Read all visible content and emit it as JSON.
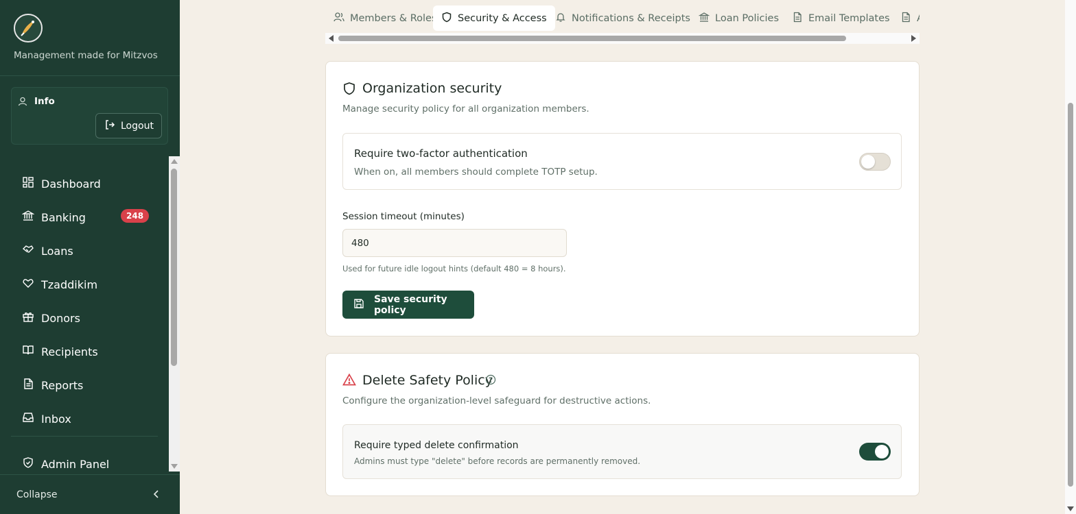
{
  "sidebar": {
    "tagline": "Management made for Mitzvos",
    "user_label": "Info",
    "logout_label": "Logout",
    "nav": [
      {
        "label": "Dashboard",
        "icon": "dashboard-icon"
      },
      {
        "label": "Banking",
        "icon": "bank-icon",
        "badge": "248"
      },
      {
        "label": "Loans",
        "icon": "handshake-icon"
      },
      {
        "label": "Tzaddikim",
        "icon": "heart-hand-icon"
      },
      {
        "label": "Donors",
        "icon": "gift-icon"
      },
      {
        "label": "Recipients",
        "icon": "book-icon"
      },
      {
        "label": "Reports",
        "icon": "document-icon"
      },
      {
        "label": "Inbox",
        "icon": "inbox-icon"
      },
      {
        "label": "Admin Panel",
        "icon": "shield-icon"
      }
    ],
    "collapse_label": "Collapse"
  },
  "tabs": [
    {
      "label": "Members & Roles",
      "icon": "users-icon",
      "active": false
    },
    {
      "label": "Security & Access",
      "icon": "shield-icon",
      "active": true
    },
    {
      "label": "Notifications & Receipts",
      "icon": "bell-icon",
      "active": false
    },
    {
      "label": "Loan Policies",
      "icon": "bank-icon",
      "active": false
    },
    {
      "label": "Email Templates",
      "icon": "document-icon",
      "active": false
    },
    {
      "label": "A",
      "icon": "document-icon",
      "active": false
    }
  ],
  "security": {
    "title": "Organization security",
    "description": "Manage security policy for all organization members.",
    "two_factor_title": "Require two-factor authentication",
    "two_factor_desc": "When on, all members should complete TOTP setup.",
    "two_factor_enabled": false,
    "timeout_label": "Session timeout (minutes)",
    "timeout_value": "480",
    "timeout_hint": "Used for future idle logout hints (default 480 = 8 hours).",
    "save_label": "Save security policy"
  },
  "delete_policy": {
    "title": "Delete Safety Policy",
    "description": "Configure the organization-level safeguard for destructive actions.",
    "confirm_title": "Require typed delete confirmation",
    "confirm_desc": "Admins must type \"delete\" before records are permanently removed.",
    "confirm_enabled": true
  },
  "colors": {
    "sidebar": "#1e3d32",
    "accent": "#1e4d3b",
    "badge": "#d9414a",
    "background": "#f4efe7",
    "warning": "#d9414a"
  }
}
